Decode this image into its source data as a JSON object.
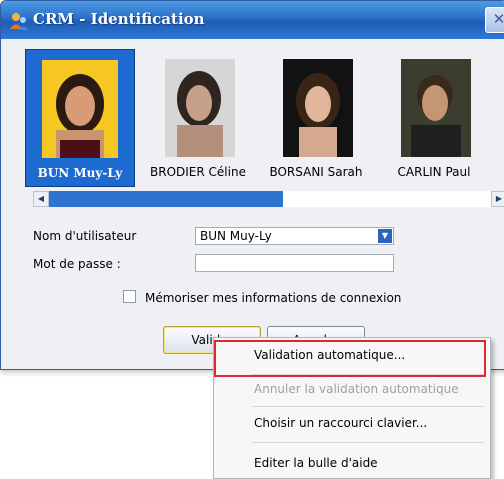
{
  "window": {
    "title": "CRM - Identification",
    "close_label": "✕"
  },
  "users": [
    {
      "name": "BUN Muy-Ly",
      "selected": true
    },
    {
      "name": "BRODIER Céline",
      "selected": false
    },
    {
      "name": "BORSANI Sarah",
      "selected": false
    },
    {
      "name": "CARLIN Paul",
      "selected": false
    }
  ],
  "form": {
    "username_label": "Nom d'utilisateur",
    "username_value": "BUN Muy-Ly",
    "password_label": "Mot de passe :",
    "password_value": "",
    "remember_label": "Mémoriser mes informations de connexion"
  },
  "buttons": {
    "validate_label": "Valider",
    "cancel_label": "Annuler"
  },
  "context_menu": {
    "items": [
      {
        "label": "Validation automatique...",
        "disabled": false
      },
      {
        "label": "Annuler la validation automatique",
        "disabled": true
      },
      {
        "label": "Choisir un raccourci clavier...",
        "disabled": false
      },
      {
        "label": "Editer la bulle d'aide",
        "disabled": false
      }
    ]
  },
  "colors": {
    "title_bar": "#2a6fc8",
    "selection": "#1d6ad1",
    "highlight_border": "#e0262f"
  }
}
